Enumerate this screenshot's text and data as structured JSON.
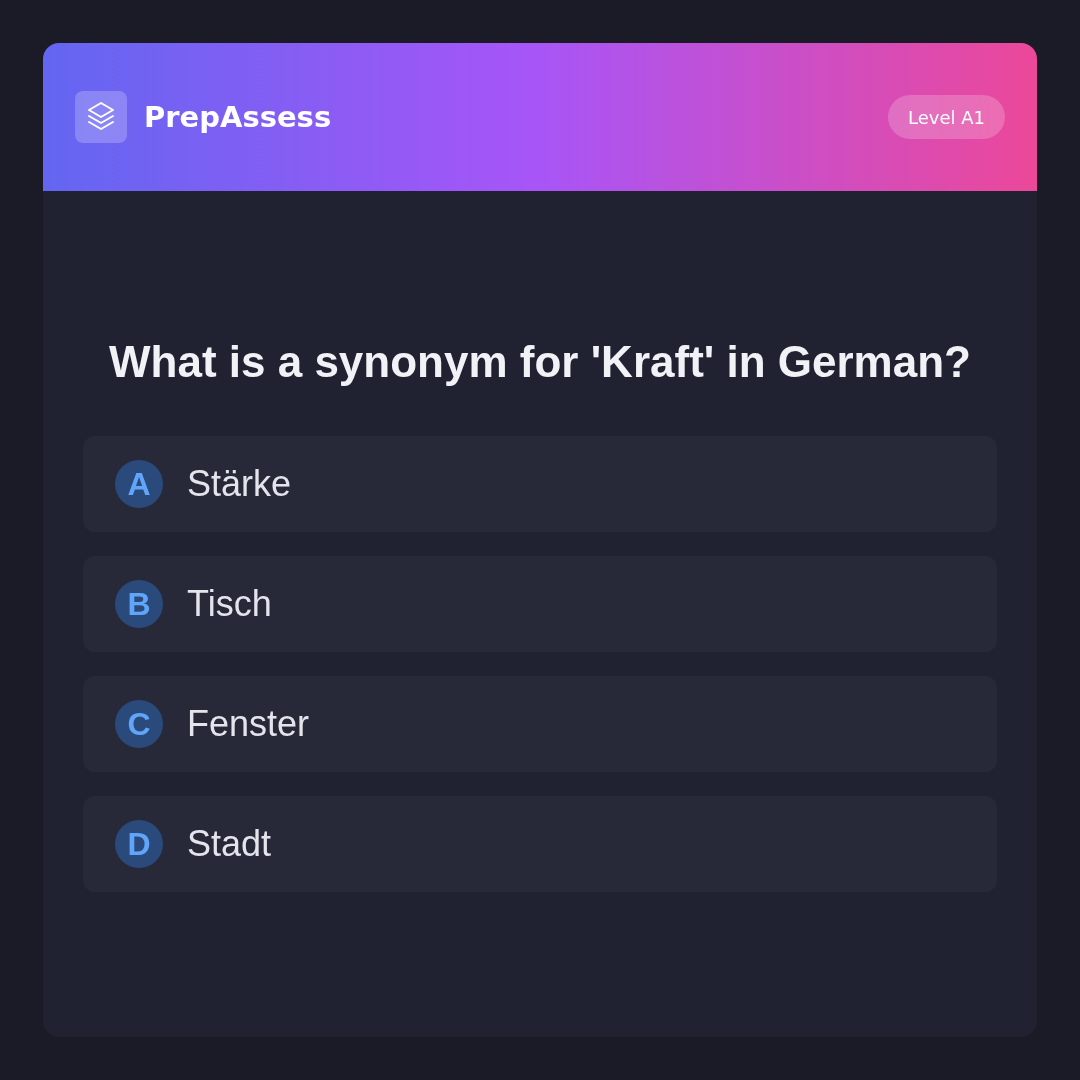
{
  "header": {
    "brand": "PrepAssess",
    "badge": "Level A1"
  },
  "question": "What is a synonym for 'Kraft' in German?",
  "options": [
    {
      "letter": "A",
      "text": "Stärke"
    },
    {
      "letter": "B",
      "text": "Tisch"
    },
    {
      "letter": "C",
      "text": "Fenster"
    },
    {
      "letter": "D",
      "text": "Stadt"
    }
  ]
}
